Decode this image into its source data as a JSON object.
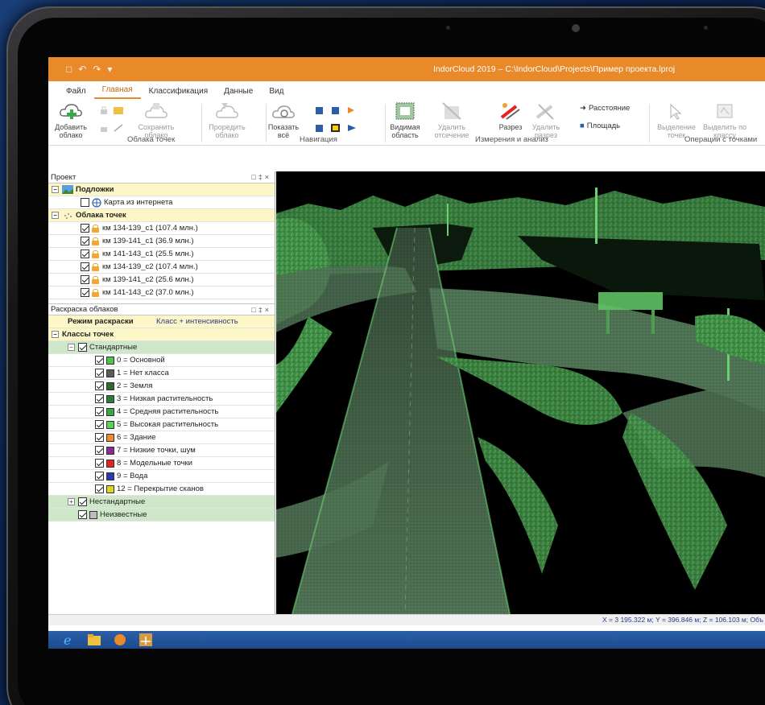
{
  "app": {
    "title": "IndorCloud 2019 – C:\\IndorCloud\\Projects\\Пример проекта.lproj"
  },
  "menu": {
    "tabs": [
      "Файл",
      "Главная",
      "Классификация",
      "Данные",
      "Вид"
    ]
  },
  "ribbon": {
    "add_cloud": "Добавить облако",
    "save_cloud": "Сохранить облако",
    "thin_cloud": "Проредить облако",
    "show_all": "Показать всё",
    "visible_area": "Видимая область",
    "remove_clip": "Удалить отсечение",
    "section": "Разрез",
    "remove_section": "Удалить разрез",
    "distance": "Расстояние",
    "area": "Площадь",
    "select_points": "Выделение точек",
    "select_by_class": "Выделить по классу",
    "groups": {
      "clouds": "Облака точек",
      "navigation": "Навигация",
      "measure": "Измерения и анализ",
      "operations": "Операции с точками"
    }
  },
  "project_panel": {
    "title": "Проект",
    "backgrounds": "Подложки",
    "internet_map": "Карта из интернета",
    "clouds_group": "Облака точек",
    "clouds": [
      "км 134-139_c1 (107.4 млн.)",
      "км 139-141_c1 (36.9 млн.)",
      "км 141-143_c1 (25.5 млн.)",
      "км 134-139_c2 (107.4 млн.)",
      "км 139-141_c2 (25.6 млн.)",
      "км 141-143_c2 (37.0 млн.)"
    ]
  },
  "color_panel": {
    "title": "Раскраска облаков",
    "mode_label": "Режим раскраски",
    "mode_value": "Класс + интенсивность",
    "classes_label": "Классы точек",
    "standard": "Стандартные",
    "classes": [
      {
        "label": "0 = Основной",
        "color": "#4fc24f"
      },
      {
        "label": "1 = Нет класса",
        "color": "#5a5a5a"
      },
      {
        "label": "2 = Земля",
        "color": "#2f6a2f"
      },
      {
        "label": "3 = Низкая растительность",
        "color": "#2f7a3f"
      },
      {
        "label": "4 = Средняя растительность",
        "color": "#3aa84a"
      },
      {
        "label": "5 = Высокая растительность",
        "color": "#5cd05c"
      },
      {
        "label": "6 = Здание",
        "color": "#f08a30"
      },
      {
        "label": "7 = Низкие точки, шум",
        "color": "#8a2a9a"
      },
      {
        "label": "8 = Модельные точки",
        "color": "#e82020"
      },
      {
        "label": "9 = Вода",
        "color": "#2a3ab0"
      },
      {
        "label": "12 = Перекрытие сканов",
        "color": "#d8d820"
      }
    ],
    "nonstandard": "Нестандартные",
    "unknown": "Неизвестные"
  },
  "status": {
    "coords": "X = 3 195.322 м; Y = 396.846 м; Z = 106.103 м; Объ"
  },
  "icons": [
    "save-icon",
    "undo-icon",
    "redo-icon",
    "add-cloud-icon",
    "lock-icon",
    "globe-icon",
    "ie-icon",
    "explorer-icon",
    "app-icon"
  ]
}
